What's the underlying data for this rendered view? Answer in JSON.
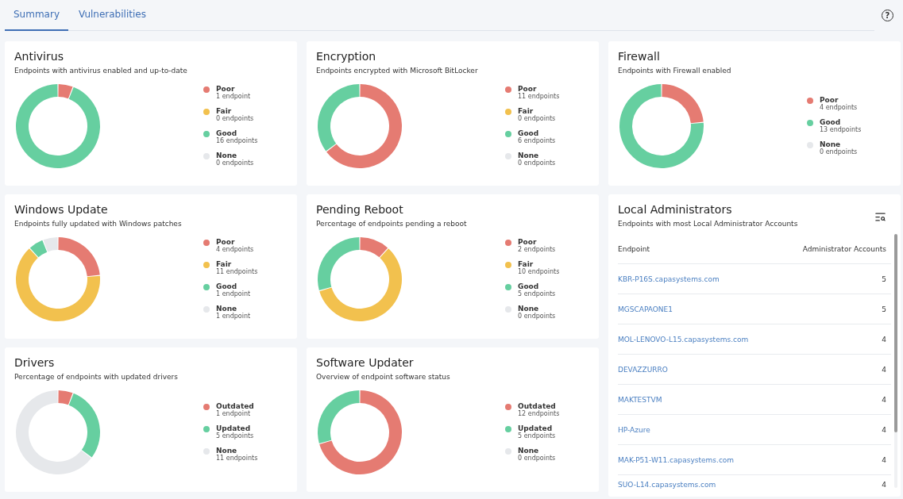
{
  "tabs": [
    {
      "label": "Summary",
      "selected": true
    },
    {
      "label": "Vulnerabilities",
      "selected": false
    }
  ],
  "help": {
    "label": "?"
  },
  "cards": [
    {
      "title": "Antivirus",
      "subtitle": "Endpoints with antivirus enabled and up-to-date",
      "legend": [
        {
          "count": "1 endpoint",
          "color": "#e57b72"
        },
        {
          "count": "0 endpoints",
          "color": "#f2c14e"
        },
        {
          "count": "16 endpoints",
          "color": "#66cfa0"
        },
        {
          "count": "0 endpoints",
          "color": "#e6e8eb"
        }
      ],
      "chart_data": {
        "type": "donut",
        "categories": [
          "Poor",
          "Fair",
          "Good",
          "None"
        ],
        "values": [
          5.88,
          0,
          94.12,
          0
        ]
      }
    },
    {
      "title": "Encryption",
      "subtitle": "Endpoints encrypted with Microsoft BitLocker",
      "legend": [
        {
          "count": "11 endpoints",
          "color": "#e57b72"
        },
        {
          "count": "0 endpoints",
          "color": "#f2c14e"
        },
        {
          "count": "6 endpoints",
          "color": "#66cfa0"
        },
        {
          "count": "0 endpoints",
          "color": "#e6e8eb"
        }
      ],
      "chart_data": {
        "type": "donut",
        "categories": [
          "Poor",
          "Fair",
          "Good",
          "None"
        ],
        "values": [
          64.71,
          0,
          35.29,
          0
        ]
      }
    },
    {
      "title": "Firewall",
      "subtitle": "Endpoints with Firewall enabled",
      "legend": [
        {
          "count": "4 endpoints",
          "color": "#e57b72"
        },
        {
          "count": "13 endpoints",
          "color": "#66cfa0"
        },
        {
          "count": "0 endpoints",
          "color": "#e6e8eb"
        }
      ],
      "chart_data": {
        "type": "donut",
        "categories": [
          "Poor",
          "Good",
          "None"
        ],
        "values": [
          23.53,
          76.47,
          0
        ]
      }
    },
    {
      "title": "Windows Update",
      "subtitle": "Endpoints fully updated with Windows patches",
      "legend": [
        {
          "count": "4 endpoints",
          "color": "#e57b72"
        },
        {
          "count": "11 endpoints",
          "color": "#f2c14e"
        },
        {
          "count": "1 endpoint",
          "color": "#66cfa0"
        },
        {
          "count": "1 endpoint",
          "color": "#e6e8eb"
        }
      ],
      "chart_data": {
        "type": "donut",
        "categories": [
          "Poor",
          "Fair",
          "Good",
          "None"
        ],
        "values": [
          23.53,
          64.71,
          5.88,
          5.88
        ]
      }
    },
    {
      "title": "Pending Reboot",
      "subtitle": "Percentage of endpoints pending a reboot",
      "legend": [
        {
          "count": "2 endpoints",
          "color": "#e57b72"
        },
        {
          "count": "10 endpoints",
          "color": "#f2c14e"
        },
        {
          "count": "5 endpoints",
          "color": "#66cfa0"
        },
        {
          "count": "0 endpoints",
          "color": "#e6e8eb"
        }
      ],
      "chart_data": {
        "type": "donut",
        "categories": [
          "Poor",
          "Fair",
          "Good",
          "None"
        ],
        "values": [
          11.76,
          58.82,
          29.42,
          0
        ]
      }
    },
    {
      "title": "Drivers",
      "subtitle": "Percentage of endpoints with updated drivers",
      "legend": [
        {
          "count": "1 endpoint",
          "color": "#e57b72"
        },
        {
          "count": "5 endpoints",
          "color": "#66cfa0"
        },
        {
          "count": "11 endpoints",
          "color": "#e6e8eb"
        }
      ],
      "chart_data": {
        "type": "donut",
        "categories": [
          "Outdated",
          "Updated",
          "None"
        ],
        "values": [
          5.88,
          29.41,
          64.71
        ]
      }
    },
    {
      "title": "Software Updater",
      "subtitle": "Overview of endpoint software status",
      "legend": [
        {
          "count": "12 endpoints",
          "color": "#e57b72"
        },
        {
          "count": "5 endpoints",
          "color": "#66cfa0"
        },
        {
          "count": "0 endpoints",
          "color": "#e6e8eb"
        }
      ],
      "chart_data": {
        "type": "donut",
        "categories": [
          "Outdated",
          "Updated",
          "None"
        ],
        "values": [
          70.59,
          29.41,
          0
        ]
      }
    }
  ],
  "admins": {
    "title": "Local Administrators",
    "subtitle": "Endpoints with most Local Administrator Accounts",
    "columns": [
      "Endpoint",
      "Administrator Accounts"
    ],
    "rows": [
      {
        "endpoint": "KBR-P16S.capasystems.com",
        "accounts": "5"
      },
      {
        "endpoint": "MGSCAPAONE1",
        "accounts": "5"
      },
      {
        "endpoint": "MOL-LENOVO-L15.capasystems.com",
        "accounts": "4"
      },
      {
        "endpoint": "DEVAZZURRO",
        "accounts": "4"
      },
      {
        "endpoint": "MAKTESTVM",
        "accounts": "4"
      },
      {
        "endpoint": "HP-Azure",
        "accounts": "4"
      },
      {
        "endpoint": "MAK-P51-W11.capasystems.com",
        "accounts": "4"
      },
      {
        "endpoint": "SUO-L14.capasystems.com",
        "accounts": "4"
      }
    ]
  }
}
